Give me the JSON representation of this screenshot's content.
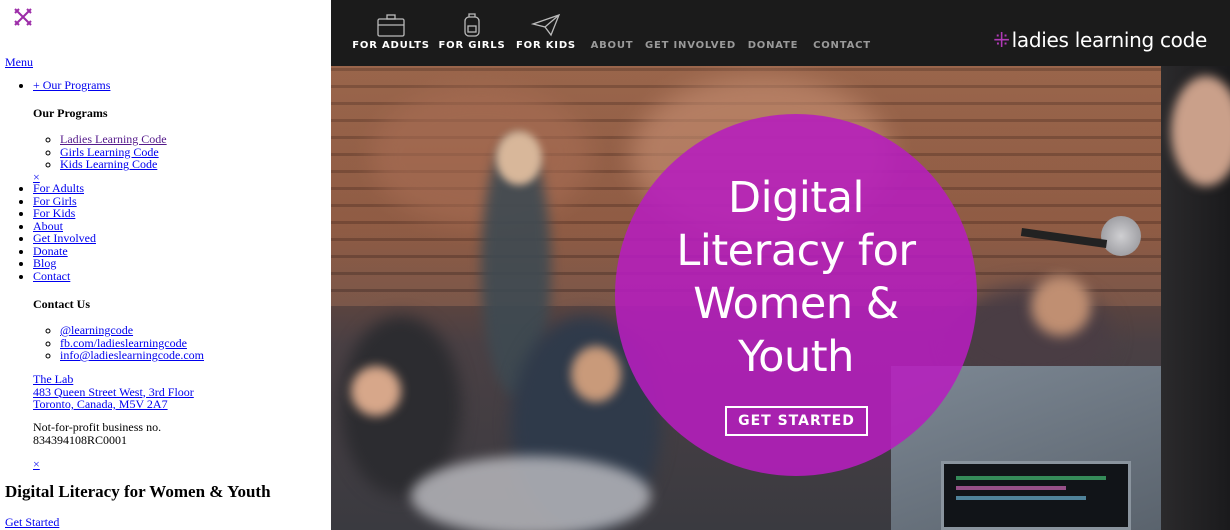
{
  "left": {
    "menu_label": "Menu",
    "programs_toggle": "+ Our Programs",
    "programs_heading": "Our Programs",
    "programs": [
      "Ladies Learning Code",
      "Girls Learning Code",
      "Kids Learning Code"
    ],
    "close_label": "×",
    "nav": [
      "For Adults",
      "For Girls",
      "For Kids",
      "About",
      "Get Involved",
      "Donate",
      "Blog",
      "Contact"
    ],
    "contact_heading": "Contact Us",
    "contact_links": [
      "@learningcode",
      "fb.com/ladieslearningcode",
      "info@ladieslearningcode.com"
    ],
    "lab": {
      "name": "The Lab",
      "street": "483 Queen Street West, 3rd Floor",
      "city": "Toronto, Canada, M5V 2A7"
    },
    "business": {
      "label": "Not-for-profit business no.",
      "number": "834394108RC0001"
    },
    "close_label_2": "×",
    "heading": "Digital Literacy for Women & Youth",
    "cta": "Get Started"
  },
  "hero": {
    "nav": [
      {
        "label": "FOR ADULTS",
        "icon": "briefcase-icon"
      },
      {
        "label": "FOR GIRLS",
        "icon": "backpack-icon"
      },
      {
        "label": "FOR KIDS",
        "icon": "paper-plane-icon"
      },
      {
        "label": "ABOUT"
      },
      {
        "label": "GET INVOLVED"
      },
      {
        "label": "DONATE"
      },
      {
        "label": "CONTACT"
      }
    ],
    "brand_mark": "⁜",
    "brand_name": "ladies learning code",
    "headline_lines": [
      "Digital",
      "Literacy for",
      "Women &",
      "Youth"
    ],
    "cta": "GET STARTED",
    "colors": {
      "accent": "#b61ebe",
      "topbar": "#1b1b1b"
    }
  }
}
